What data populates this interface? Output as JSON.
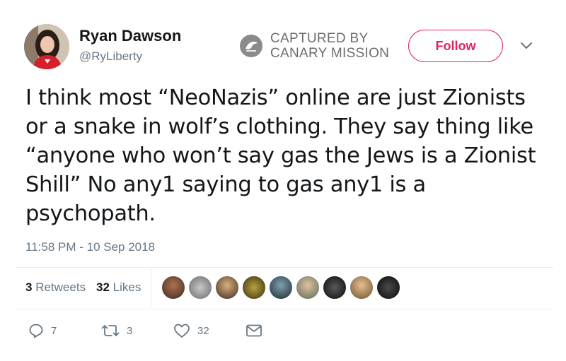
{
  "author": {
    "name": "Ryan Dawson",
    "handle": "@RyLiberty"
  },
  "watermark": {
    "line1": "CAPTURED BY",
    "line2": "CANARY MISSION",
    "icon": "canary-mission-logo"
  },
  "follow_label": "Follow",
  "tweet": {
    "text": "I think most “NeoNazis” online are just Zionists or a snake in wolf’s clothing. They say thing like “anyone who won’t say gas the Jews is a Zionist Shill” No any1 saying to gas any1 is a psychopath.",
    "timestamp": "11:58 PM - 10 Sep 2018"
  },
  "stats": {
    "retweets_count": "3",
    "retweets_label": "Retweets",
    "likes_count": "32",
    "likes_label": "Likes"
  },
  "actions": {
    "reply_count": "7",
    "retweet_count": "3",
    "like_count": "32"
  },
  "colors": {
    "accent": "#e0245e",
    "secondary_text": "#657786",
    "divider": "#e6ecf0"
  },
  "icons": [
    "chevron-down-icon",
    "reply-icon",
    "retweet-icon",
    "heart-icon",
    "message-icon"
  ]
}
